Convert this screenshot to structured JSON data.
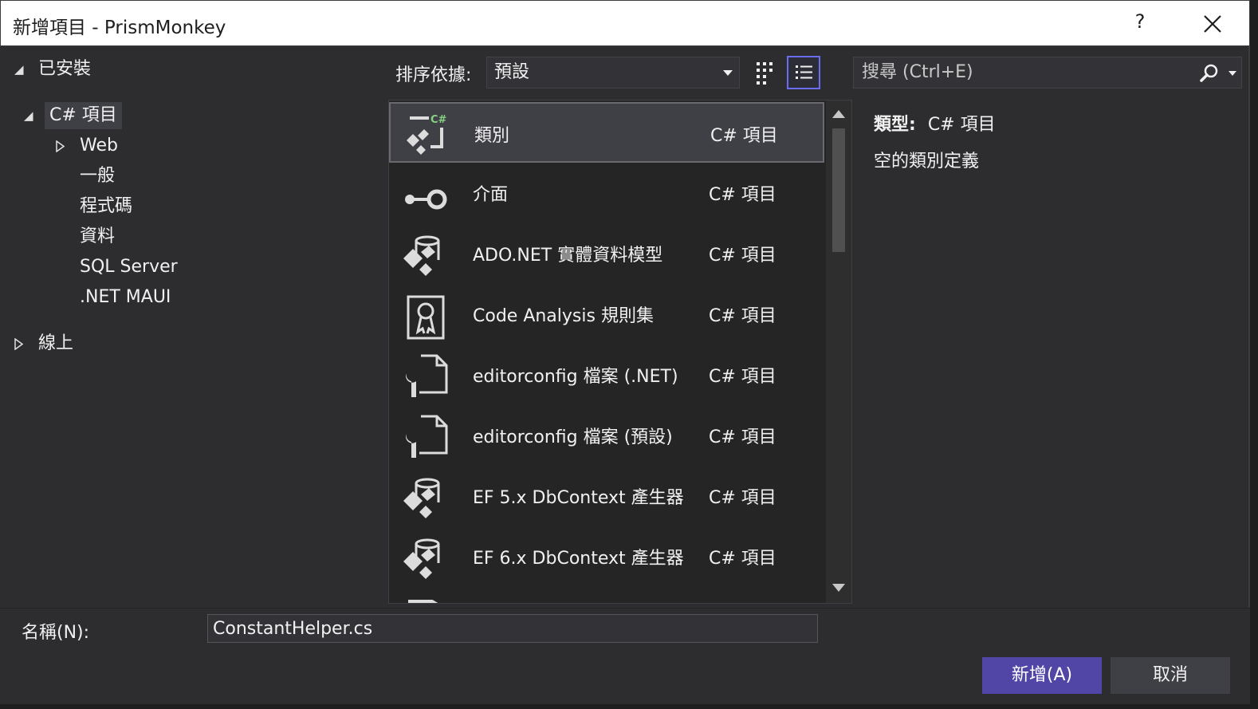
{
  "window": {
    "title": "新增項目 - PrismMonkey",
    "help_label": "?"
  },
  "tree": {
    "installed": "已安裝",
    "csharp": "C# 項目",
    "children": [
      "Web",
      "一般",
      "程式碼",
      "資料",
      "SQL Server",
      ".NET MAUI"
    ],
    "online": "線上"
  },
  "toolbar": {
    "sort_label": "排序依據:",
    "sort_value": "預設",
    "search_placeholder": "搜尋 (Ctrl+E)"
  },
  "templates": [
    {
      "name": "類別",
      "lang": "C# 項目",
      "icon": "class-icon",
      "selected": true
    },
    {
      "name": "介面",
      "lang": "C# 項目",
      "icon": "interface-icon",
      "selected": false
    },
    {
      "name": "ADO.NET 實體資料模型",
      "lang": "C# 項目",
      "icon": "entity-model-icon",
      "selected": false
    },
    {
      "name": "Code Analysis 規則集",
      "lang": "C# 項目",
      "icon": "ruleset-icon",
      "selected": false
    },
    {
      "name": "editorconfig 檔案 (.NET)",
      "lang": "C# 項目",
      "icon": "editorconfig-icon",
      "selected": false
    },
    {
      "name": "editorconfig 檔案 (預設)",
      "lang": "C# 項目",
      "icon": "editorconfig-icon",
      "selected": false
    },
    {
      "name": "EF 5.x DbContext 產生器",
      "lang": "C# 項目",
      "icon": "dbcontext-icon",
      "selected": false
    },
    {
      "name": "EF 6.x DbContext 產生器",
      "lang": "C# 項目",
      "icon": "dbcontext-icon",
      "selected": false
    }
  ],
  "details": {
    "type_label": "類型:",
    "type_value": "C# 項目",
    "description": "空的類別定義"
  },
  "footer": {
    "name_label": "名稱(N):",
    "name_value": "ConstantHelper.cs",
    "add_label": "新增(A)",
    "cancel_label": "取消"
  },
  "colors": {
    "accent": "#5146a6",
    "background": "#2d2d30",
    "list_background": "#252526",
    "selected_row": "#3f3f46"
  }
}
